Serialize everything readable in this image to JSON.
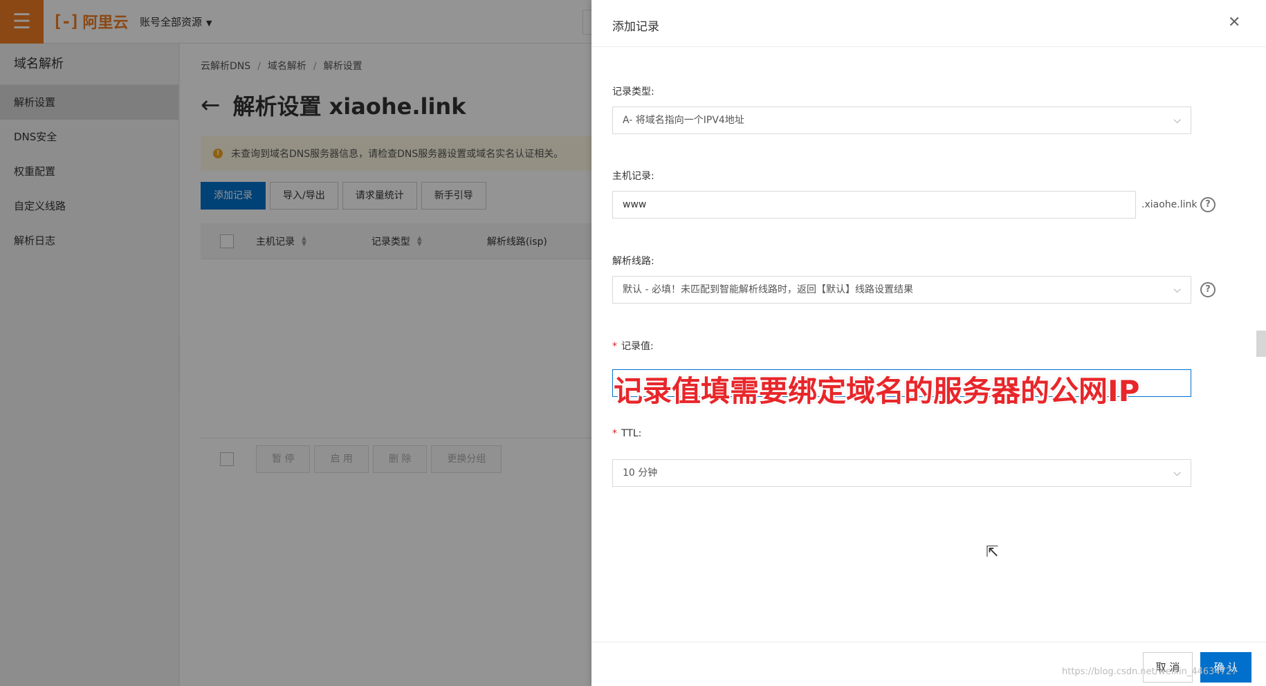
{
  "topbar": {
    "menu_icon": "hamburger-icon",
    "logo_mark": "[-]",
    "logo_text": "阿里云",
    "account_label": "账号全部资源"
  },
  "sidebar": {
    "title": "域名解析",
    "items": [
      {
        "label": "解析设置",
        "active": true
      },
      {
        "label": "DNS安全"
      },
      {
        "label": "权重配置"
      },
      {
        "label": "自定义线路"
      },
      {
        "label": "解析日志"
      }
    ]
  },
  "main": {
    "breadcrumb": [
      "云解析DNS",
      "域名解析",
      "解析设置"
    ],
    "title": "解析设置 xiaohe.link",
    "notice": "未查询到域名DNS服务器信息，请检查DNS服务器设置或域名实名认证相关。",
    "toolbar": [
      "添加记录",
      "导入/导出",
      "请求量统计",
      "新手引导"
    ],
    "table_headers": [
      "主机记录",
      "记录类型",
      "解析线路(isp)"
    ],
    "footer_buttons": [
      "暂 停",
      "启 用",
      "删 除",
      "更换分组"
    ]
  },
  "drawer": {
    "title": "添加记录",
    "record_type_label": "记录类型:",
    "record_type_value": "A- 将域名指向一个IPV4地址",
    "host_label": "主机记录:",
    "host_value": "www",
    "host_suffix": ".xiaohe.link",
    "line_label": "解析线路:",
    "line_value": "默认 - 必填！未匹配到智能解析线路时，返回【默认】线路设置结果",
    "value_label": "记录值:",
    "annotation": "记录值填需要绑定域名的服务器的公网IP",
    "ttl_label": "TTL:",
    "ttl_value": "10 分钟",
    "cancel": "取 消",
    "confirm": "确 认"
  },
  "watermark": "https://blog.csdn.net/weixin_44634727",
  "colors": {
    "accent": "#0070cc",
    "brand": "#f07c24",
    "required": "#e02020"
  }
}
